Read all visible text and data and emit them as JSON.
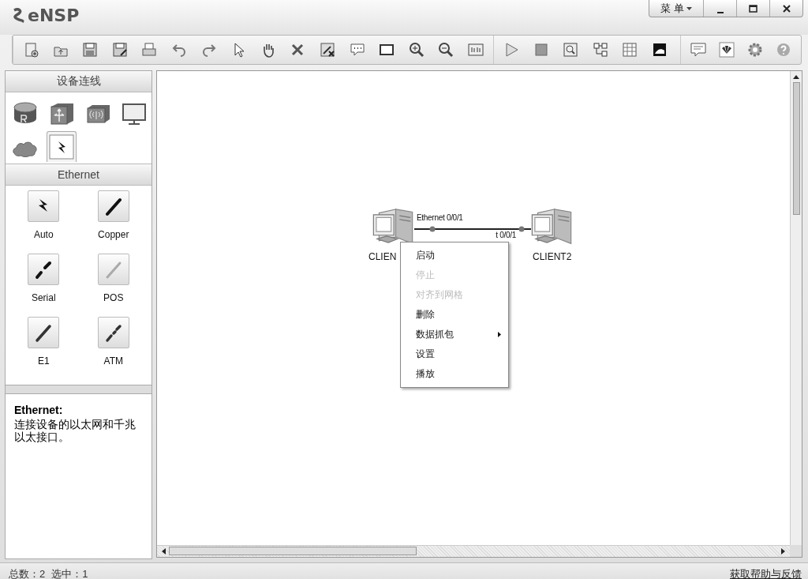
{
  "window": {
    "title": "eNSP",
    "menu_label": "菜 单"
  },
  "device_panel": {
    "title": "设备连线",
    "categories": [
      {
        "kind": "router",
        "selected": false
      },
      {
        "kind": "switch",
        "selected": false
      },
      {
        "kind": "wireless",
        "selected": false
      },
      {
        "kind": "pc",
        "selected": false
      },
      {
        "kind": "cloud",
        "selected": false
      },
      {
        "kind": "cable",
        "selected": true
      }
    ]
  },
  "cable_panel": {
    "title": "Ethernet",
    "cables": [
      {
        "label": "Auto",
        "kind": "auto"
      },
      {
        "label": "Copper",
        "kind": "copper"
      },
      {
        "label": "Serial",
        "kind": "serial"
      },
      {
        "label": "POS",
        "kind": "pos"
      },
      {
        "label": "E1",
        "kind": "e1"
      },
      {
        "label": "ATM",
        "kind": "atm"
      }
    ]
  },
  "description": {
    "title": "Ethernet:",
    "text": "连接设备的以太网和千兆以太接口。"
  },
  "canvas": {
    "devices": [
      {
        "label": "CLIEN"
      },
      {
        "label": "CLIENT2"
      }
    ],
    "link": {
      "label_a": "Ethernet 0/0/1",
      "label_b": "t 0/0/1"
    }
  },
  "context_menu": {
    "items": [
      {
        "label": "启动",
        "disabled": false,
        "submenu": false
      },
      {
        "label": "停止",
        "disabled": true,
        "submenu": false
      },
      {
        "label": "对齐到网格",
        "disabled": true,
        "submenu": false
      },
      {
        "label": "删除",
        "disabled": false,
        "submenu": false
      },
      {
        "label": "数据抓包",
        "disabled": false,
        "submenu": true
      },
      {
        "label": "设置",
        "disabled": false,
        "submenu": false
      },
      {
        "label": "播放",
        "disabled": false,
        "submenu": false
      }
    ]
  },
  "status_bar": {
    "total": "总数：2",
    "selected": "选中：1",
    "help_link": "获取帮助与反馈"
  }
}
